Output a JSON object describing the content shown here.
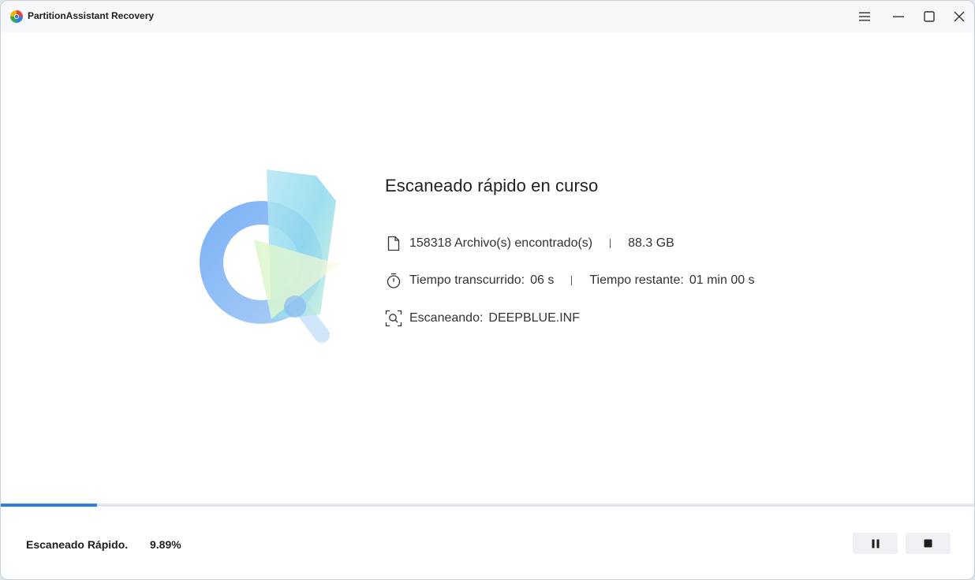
{
  "window": {
    "title": "PartitionAssistant Recovery",
    "logo_icon": "app-logo-icon"
  },
  "titlebar_buttons": {
    "menu_icon": "hamburger-menu-icon",
    "minimize_icon": "minimize-icon",
    "maximize_icon": "maximize-icon",
    "close_icon": "close-icon"
  },
  "scan": {
    "title": "Escaneado rápido en curso",
    "files_found": "158318 Archivo(s) encontrado(s)",
    "size_found": "88.3 GB",
    "elapsed_label": "Tiempo transcurrido:",
    "elapsed_value": "06 s",
    "remaining_label": "Tiempo restante:",
    "remaining_value": "01 min 00 s",
    "scanning_label": "Escaneando:",
    "scanning_value": "DEEPBLUE.INF"
  },
  "footer": {
    "mode_label": "Escaneado Rápido.",
    "percent": "9.89%",
    "progress_fraction": 0.0989,
    "pause_icon": "pause-icon",
    "stop_icon": "stop-icon"
  },
  "colors": {
    "accent": "#2f7fe0",
    "progress_track": "#e3e6ea",
    "button_bg": "#eef0f3"
  }
}
